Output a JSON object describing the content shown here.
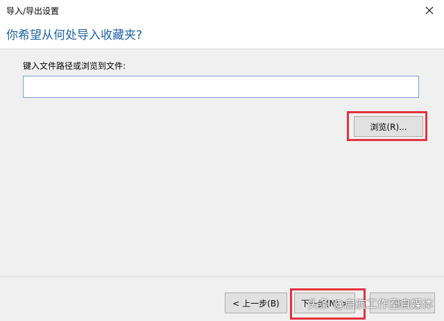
{
  "window": {
    "title": "导入/导出设置"
  },
  "header": {
    "heading": "你希望从何处导入收藏夹?"
  },
  "form": {
    "path_label": "键入文件路径或浏览到文件:",
    "path_value": "",
    "browse_label": "浏览(R)..."
  },
  "footer": {
    "back_label": "< 上一步(B)",
    "next_label": "下一步(N) >",
    "cancel_label": "取消"
  },
  "watermark": {
    "text": "头条 @启航工作室自媒体"
  },
  "colors": {
    "heading": "#1e64a8",
    "highlight": "#e5323c",
    "panel": "#f0f0f0"
  },
  "icons": {
    "close": "close-icon"
  }
}
